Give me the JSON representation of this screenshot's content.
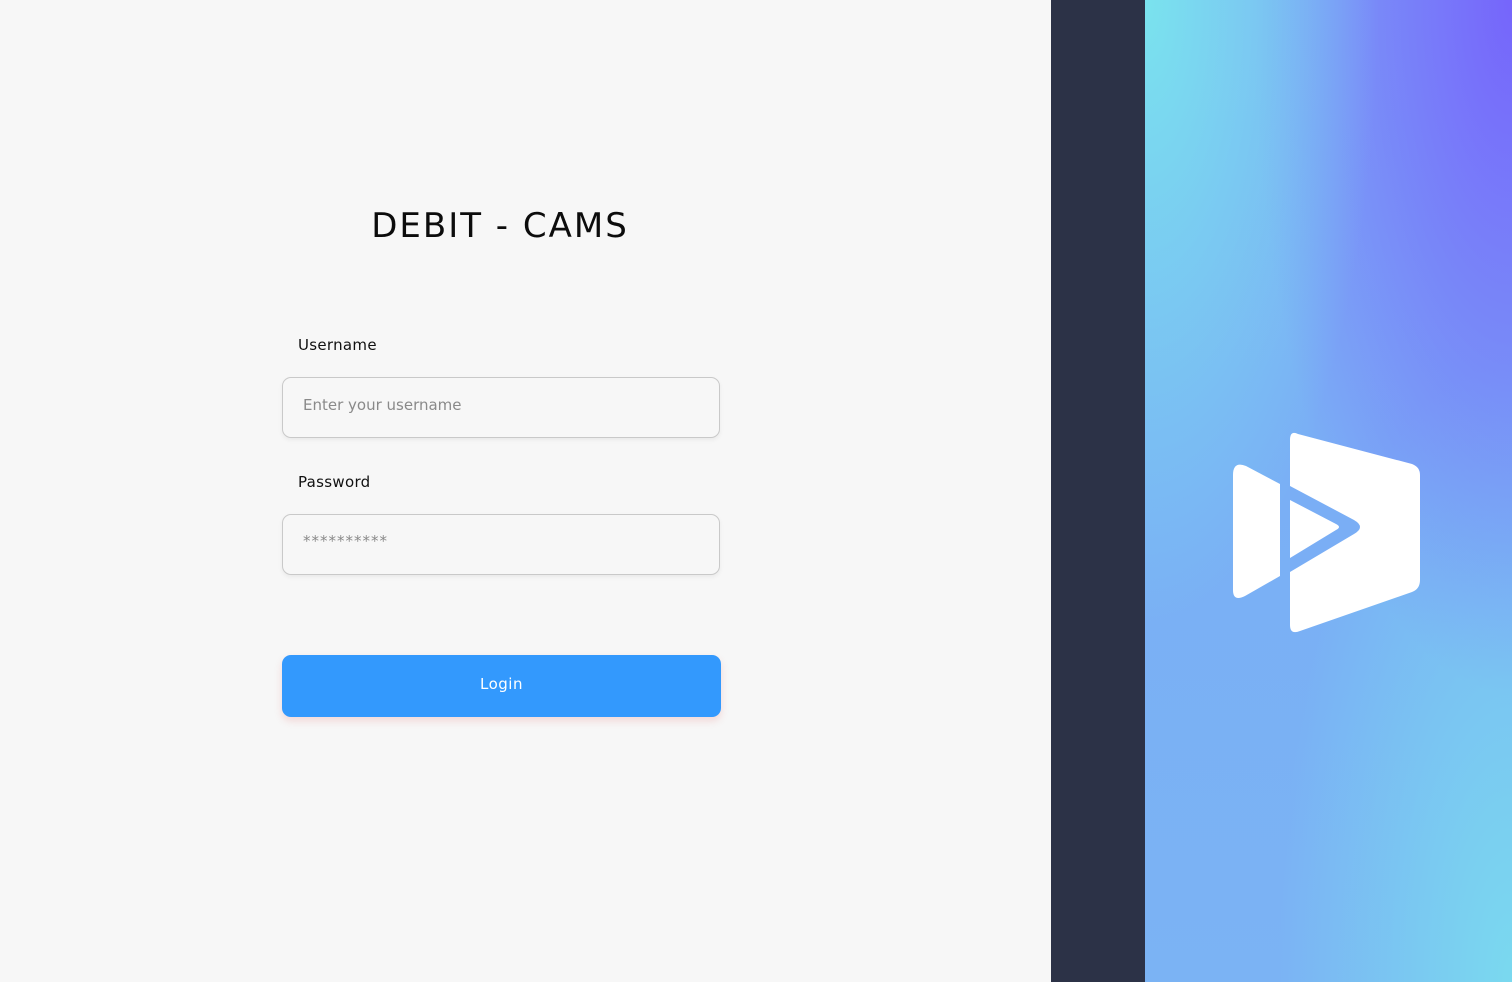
{
  "app": {
    "title": "DEBIT - CAMS"
  },
  "form": {
    "username_label": "Username",
    "username_placeholder": "Enter your username",
    "username_value": "",
    "password_label": "Password",
    "password_placeholder": "**********",
    "password_value": "",
    "login_label": "Login"
  },
  "brand": {
    "logo_icon": "play-video-logo-icon",
    "accent_color": "#3399fd",
    "sidebar_color": "#2c3247"
  }
}
